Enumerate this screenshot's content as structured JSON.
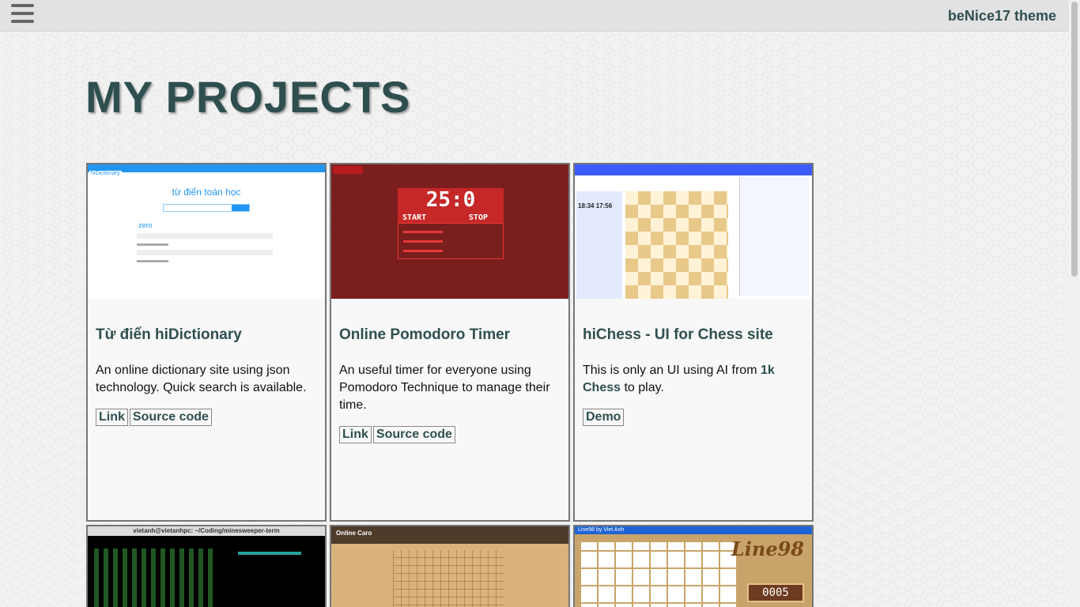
{
  "header": {
    "theme_title": "beNice17 theme"
  },
  "page": {
    "title": "MY PROJECTS"
  },
  "projects": [
    {
      "title": "Từ điển hiDictionary",
      "description": "An online dictionary site using json technology. Quick search is available.",
      "buttons": [
        "Link",
        "Source code"
      ],
      "thumbnail": "hidictionary-screenshot",
      "thumb_text": {
        "brand": "hiDictionary",
        "heading": "từ điển toán học",
        "word": "zero"
      }
    },
    {
      "title": "Online Pomodoro Timer",
      "description": "An useful timer for everyone using Pomodoro Technique to manage their time.",
      "buttons": [
        "Link",
        "Source code"
      ],
      "thumbnail": "pomodoro-screenshot",
      "thumb_text": {
        "clock": "25:0",
        "start": "START",
        "stop": "STOP"
      }
    },
    {
      "title": "hiChess - UI for Chess site",
      "description_prefix": "This is only an UI using AI from ",
      "description_link": "1k Chess",
      "description_suffix": " to play.",
      "buttons": [
        "Demo"
      ],
      "thumbnail": "hichess-screenshot",
      "thumb_text": {
        "time_a": "18:34",
        "time_b": "17:56"
      }
    },
    {
      "thumbnail": "minesweeper-terminal-screenshot",
      "thumb_text": {
        "window_title": "vietanh@vietanhpc: ~/Coding/minesweeper-term"
      }
    },
    {
      "thumbnail": "online-caro-screenshot",
      "thumb_text": {
        "title": "Online Caro"
      }
    },
    {
      "thumbnail": "line98-screenshot",
      "thumb_text": {
        "window_title": "Line98 by Viet Anh",
        "logo": "Line98",
        "score": "0005"
      }
    }
  ],
  "colors": {
    "accent": "#2f4f4f",
    "topbar": "#e2e2e2",
    "card_border": "#777777"
  }
}
